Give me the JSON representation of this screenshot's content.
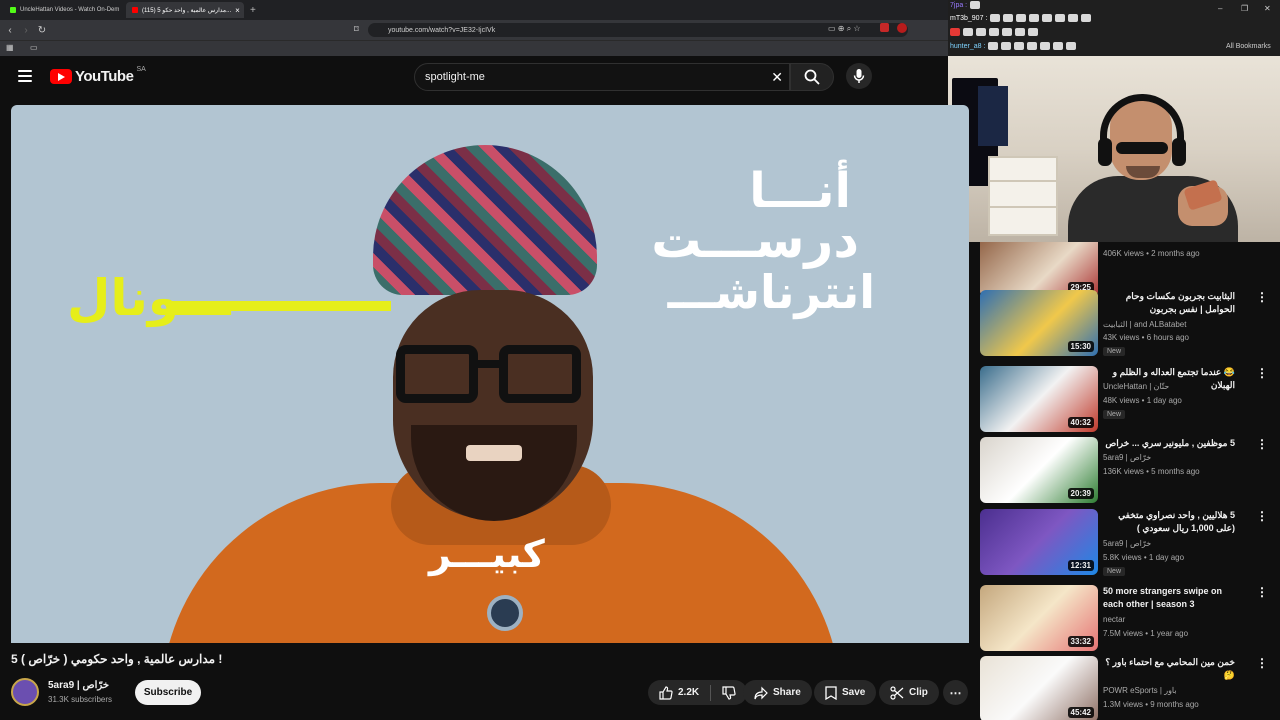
{
  "browser": {
    "tabs": [
      {
        "label": "UncleHattan Videos - Watch On-Dem",
        "fav_color": "#53fc18"
      },
      {
        "label": "(115) 5 مدارس عالمية , واحد حكو...",
        "fav_color": "#ff0000"
      }
    ],
    "url": "youtube.com/watch?v=JE32-IjcIVk",
    "bookmarks_label": "All Bookmarks"
  },
  "stream_chat": {
    "lines": [
      {
        "user": "7jpa :",
        "color": "#9a7bff"
      },
      {
        "user": "mT3b_907 :",
        "color": "#ffffff"
      },
      {
        "user": "hunter_a8 :",
        "color": "#7fd3ff"
      }
    ]
  },
  "youtube": {
    "logo_text": "YouTube",
    "country": "SA",
    "search_value": "spotlight-me",
    "brand_red": "#ff0000"
  },
  "video": {
    "overlay": {
      "line1": "أنـــا",
      "line2": "درســـت",
      "line3": "انترناشـــ",
      "line4": "ـــونال",
      "line5": "كبيـــر"
    },
    "title": "5 مدارس عالمية , واحد حكومي ( خرّاص ) !",
    "channel": "5ara9 | خرّاص",
    "subscribers": "31.3K subscribers",
    "subscribe_label": "Subscribe",
    "likes": "2.2K",
    "share_label": "Share",
    "save_label": "Save",
    "clip_label": "Clip"
  },
  "recommendations": [
    {
      "title": "",
      "channel": "",
      "meta": "406K views • 2 months ago",
      "duration": "29:25",
      "is_new": false,
      "thumb": "#8b5a3c"
    },
    {
      "title": "البثابيت بجربون مكسات وحام الحوامل | نفس بجربون",
      "channel": "الثبابيت | and ALBatabet",
      "meta": "43K views • 6 hours ago",
      "duration": "15:30",
      "is_new": true,
      "thumb": "#2f6fb2"
    },
    {
      "title": "😂 عندما تجتمع العداله و الظلم و الهبلان",
      "channel": "UncleHattan | حتّان",
      "meta": "48K views • 1 day ago",
      "duration": "40:32",
      "is_new": true,
      "thumb": "#3a6d8c"
    },
    {
      "title": "5 موظفين , مليونير سري ... خراص",
      "channel": "5ara9 | خرّاص",
      "meta": "136K views • 5 months ago",
      "duration": "20:39",
      "is_new": false,
      "thumb": "#d9d4cc"
    },
    {
      "title": "5 هلاليين , واحد نصراوي متخفي (على 1,000 ريال سعودي )",
      "channel": "5ara9 | خرّاص",
      "meta": "5.8K views • 1 day ago",
      "duration": "12:31",
      "is_new": true,
      "thumb": "#4b2f8f"
    },
    {
      "title": "50 more strangers swipe on each other | season 3",
      "channel": "nectar",
      "meta": "7.5M views • 1 year ago",
      "duration": "33:32",
      "is_new": false,
      "thumb": "#c4a77d"
    },
    {
      "title": "خمن مين المحامي مع احتماء باور ؟ 🤔",
      "channel": "POWR eSports | باور",
      "meta": "1.3M views • 9 months ago",
      "duration": "45:42",
      "is_new": false,
      "thumb": "#e9e2d6"
    }
  ]
}
